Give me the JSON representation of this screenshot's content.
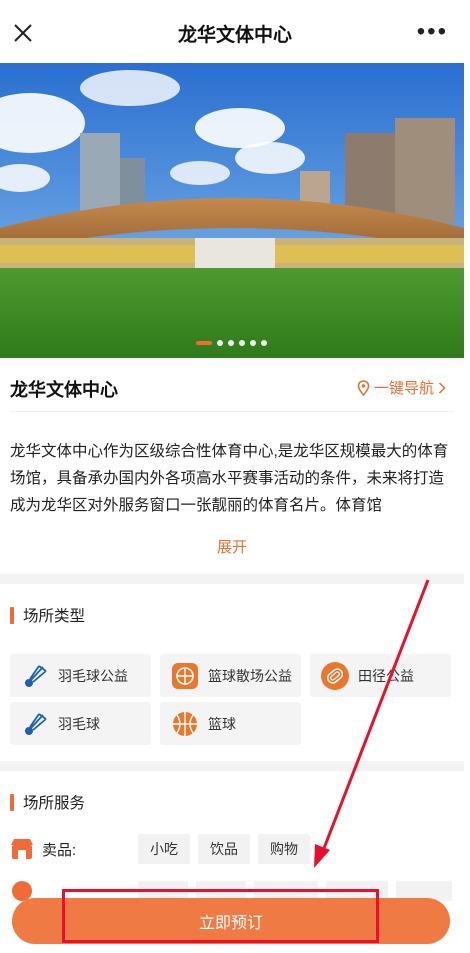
{
  "header": {
    "title": "龙华文体中心",
    "more_label": "•••"
  },
  "banner": {
    "slides": 6,
    "active_slide": 1
  },
  "venue": {
    "name": "龙华文体中心",
    "nav_label": "一键导航",
    "description": "龙华文体中心作为区级综合性体育中心,是龙华区规模最大的体育场馆，具备承办国内外各项高水平赛事活动的条件，未来将打造成为龙华区对外服务窗口一张靓丽的体育名片。体育馆",
    "expand_label": "展开"
  },
  "venue_types": {
    "heading": "场所类型",
    "items": [
      {
        "label": "羽毛球公益",
        "icon": "shuttlecock-icon"
      },
      {
        "label": "篮球散场公益",
        "icon": "basketball-icon"
      },
      {
        "label": "田径公益",
        "icon": "track-icon"
      },
      {
        "label": "羽毛球",
        "icon": "shuttlecock-icon"
      },
      {
        "label": "篮球",
        "icon": "basketball-icon"
      }
    ]
  },
  "services": {
    "heading": "场所服务",
    "sales_label": "卖品:",
    "sales_tags": [
      "小吃",
      "饮品",
      "购物"
    ]
  },
  "booking": {
    "button_label": "立即预订"
  },
  "colors": {
    "accent": "#f06b38",
    "annotation_red": "#e8102b"
  }
}
